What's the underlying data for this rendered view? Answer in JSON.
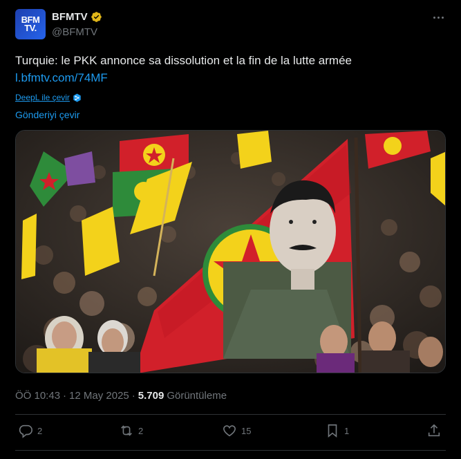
{
  "author": {
    "avatar_line1": "BFM",
    "avatar_line2": "TV.",
    "name": "BFMTV",
    "handle": "@BFMTV"
  },
  "icons": {
    "verified": "verified-badge-icon",
    "more": "more-options-icon",
    "deepl": "deepl-icon",
    "reply": "reply-icon",
    "retweet": "retweet-icon",
    "like": "like-icon",
    "bookmark": "bookmark-icon",
    "share": "share-icon"
  },
  "tweet": {
    "text": "Turquie: le PKK annonce sa dissolution et la fin de la lutte armée",
    "link": "l.bfmtv.com/74MF",
    "deepl_label": "DeepL ile çevir",
    "translate_label": "Gönderiyi çevir"
  },
  "meta": {
    "time": "ÖÖ 10:43",
    "separator1": "·",
    "date": "12 May 2025",
    "separator2": "·",
    "views": "5.709",
    "views_label": "Görüntüleme"
  },
  "actions": {
    "replies": "2",
    "retweets": "2",
    "likes": "15",
    "bookmarks": "1"
  },
  "colors": {
    "background": "#000000",
    "link": "#1d9bf0",
    "muted": "#71767b",
    "verified_gold": "#e2b719",
    "flag_red": "#d1202a",
    "flag_yellow": "#f3d21b",
    "flag_green": "#2e8b3a"
  }
}
